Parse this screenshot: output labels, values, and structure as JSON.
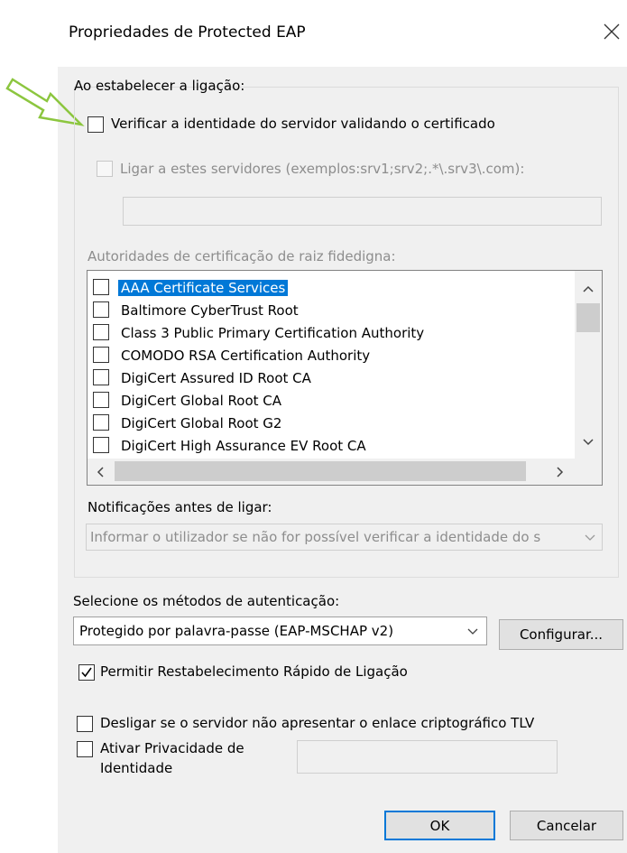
{
  "window": {
    "title": "Propriedades de Protected EAP"
  },
  "connect_group": {
    "heading": "Ao estabelecer a ligação:",
    "verify_identity_label": "Verificar a identidade do servidor validando o certificado",
    "connect_servers_label": "Ligar a estes servidores (exemplos:srv1;srv2;.*\\.srv3\\.com):",
    "servers_value": "",
    "trusted_ca_label": "Autoridades de certificação de raiz fidedigna:",
    "trusted_ca_items": [
      {
        "label": "AAA Certificate Services",
        "checked": false,
        "selected": true
      },
      {
        "label": "Baltimore CyberTrust Root",
        "checked": false,
        "selected": false
      },
      {
        "label": "Class 3 Public Primary Certification Authority",
        "checked": false,
        "selected": false
      },
      {
        "label": "COMODO RSA Certification Authority",
        "checked": false,
        "selected": false
      },
      {
        "label": "DigiCert Assured ID Root CA",
        "checked": false,
        "selected": false
      },
      {
        "label": "DigiCert Global Root CA",
        "checked": false,
        "selected": false
      },
      {
        "label": "DigiCert Global Root G2",
        "checked": false,
        "selected": false
      },
      {
        "label": "DigiCert High Assurance EV Root CA",
        "checked": false,
        "selected": false
      }
    ],
    "notifications_label": "Notificações antes de ligar:",
    "notifications_value": "Informar o utilizador se não for possível verificar a identidade do s"
  },
  "auth": {
    "methods_label": "Selecione os métodos de autenticação:",
    "method_value": "Protegido por palavra-passe (EAP-MSCHAP v2)",
    "configure_label": "Configurar...",
    "fast_reconnect_label": "Permitir Restabelecimento Rápido de Ligação",
    "fast_reconnect_checked": true,
    "disconnect_tlv_label": "Desligar se o servidor não apresentar o enlace criptográfico TLV",
    "identity_privacy_label_1": "Ativar Privacidade de",
    "identity_privacy_label_2": "Identidade",
    "identity_privacy_value": ""
  },
  "buttons": {
    "ok": "OK",
    "cancel": "Cancelar"
  },
  "colors": {
    "selection": "#0078d7",
    "annotation_arrow": "#8cc63f"
  }
}
